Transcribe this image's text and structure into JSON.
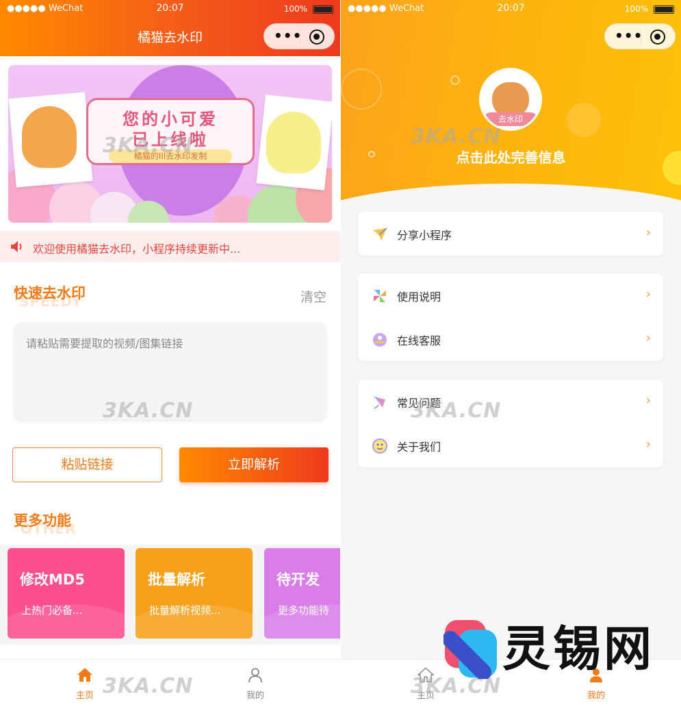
{
  "status_bar": {
    "carrier": "●●●●● WeChat",
    "time": "20:07",
    "battery": "100%"
  },
  "left": {
    "nav_title": "橘猫去水印",
    "banner": {
      "line1": "您的小可爱",
      "line2": "已上线啦",
      "line3": "橘猫的III去水印发制"
    },
    "notice": "欢迎使用橘猫去水印，小程序持续更新中...",
    "quick": {
      "title": "快速去水印",
      "subtitle": "SPEEDY",
      "clear": "清空",
      "placeholder": "请粘贴需要提取的视频/图集链接"
    },
    "buttons": {
      "paste": "粘贴链接",
      "parse": "立即解析"
    },
    "more": {
      "title": "更多功能",
      "subtitle": "OTHER"
    },
    "features": [
      {
        "title": "修改MD5",
        "sub": "上热门必备...",
        "color": "#fb4f8e"
      },
      {
        "title": "批量解析",
        "sub": "批量解析视频...",
        "color": "#f7a01a"
      },
      {
        "title": "待开发",
        "sub": "更多功能待",
        "color": "#d97ee9"
      }
    ],
    "tabs": [
      {
        "label": "主页",
        "active": true
      },
      {
        "label": "我的",
        "active": false
      }
    ]
  },
  "right": {
    "avatar_label": "去水印",
    "profile_text": "点击此处完善信息",
    "menu_groups": [
      [
        {
          "label": "分享小程序",
          "icon": "paper-plane-icon"
        }
      ],
      [
        {
          "label": "使用说明",
          "icon": "pinwheel-icon"
        },
        {
          "label": "在线客服",
          "icon": "service-icon"
        }
      ],
      [
        {
          "label": "常见问题",
          "icon": "kite-icon"
        },
        {
          "label": "关于我们",
          "icon": "smile-icon"
        }
      ]
    ],
    "tabs": [
      {
        "label": "主页",
        "active": false
      },
      {
        "label": "我的",
        "active": true
      }
    ]
  },
  "watermark": "3KA.CN",
  "brand": "灵锡网",
  "colors": {
    "orange": "#f07a16",
    "red": "#ee3a1e",
    "yellow": "#fdb40e",
    "arrow": "#f6a33b"
  }
}
